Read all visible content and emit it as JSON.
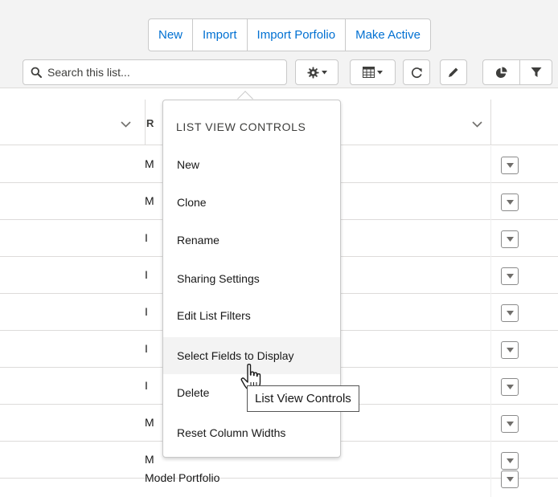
{
  "actions": {
    "new_label": "New",
    "import_label": "Import",
    "import_portfolio_label": "Import Porfolio",
    "make_active_label": "Make Active"
  },
  "search": {
    "placeholder": "Search this list..."
  },
  "icons": {
    "list_controls": "gear-icon",
    "display_as": "table-icon",
    "refresh": "refresh-icon",
    "edit": "pencil-icon",
    "charts": "pie-chart-icon",
    "filters": "filter-icon"
  },
  "table": {
    "column_r_header": "R",
    "rows": [
      "M",
      "M",
      "I",
      "I",
      "I",
      "I",
      "I",
      "M",
      "M",
      "Model Portfolio"
    ]
  },
  "menu": {
    "title": "LIST VIEW CONTROLS",
    "items": [
      "New",
      "Clone",
      "Rename",
      "Sharing Settings",
      "Edit List Filters",
      "Select Fields to Display",
      "Delete",
      "Reset Column Widths"
    ],
    "hovered_item": "Select Fields to Display"
  },
  "tooltip": {
    "text": "List View Controls"
  },
  "colors": {
    "link_blue": "#0070d2",
    "border": "#c9c9c9",
    "topbar_bg": "#f3f3f3",
    "hover_bg": "#f3f3f3"
  }
}
